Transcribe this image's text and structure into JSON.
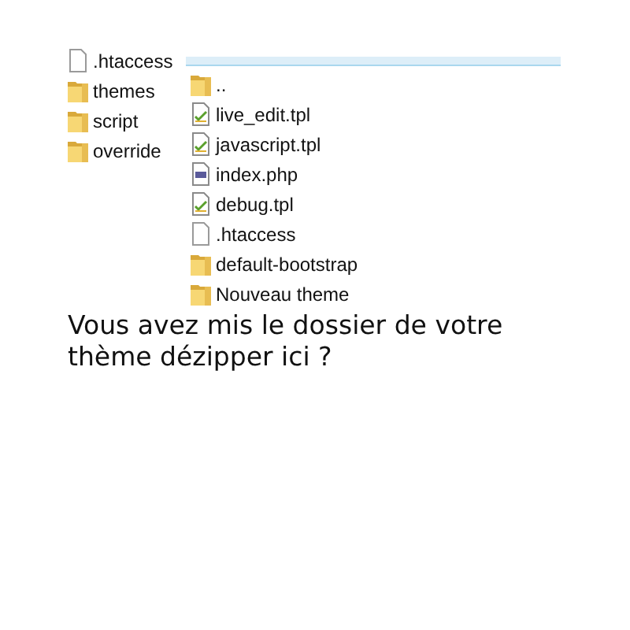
{
  "left_list": [
    {
      "kind": "file",
      "name": ".htaccess"
    },
    {
      "kind": "folder",
      "name": "themes"
    },
    {
      "kind": "folder",
      "name": "script"
    },
    {
      "kind": "folder",
      "name": "override"
    }
  ],
  "right_list": [
    {
      "kind": "folder",
      "name": ".."
    },
    {
      "kind": "tpl",
      "name": "live_edit.tpl"
    },
    {
      "kind": "tpl",
      "name": "javascript.tpl"
    },
    {
      "kind": "php",
      "name": "index.php"
    },
    {
      "kind": "tpl",
      "name": "debug.tpl"
    },
    {
      "kind": "file",
      "name": ".htaccess"
    },
    {
      "kind": "folder",
      "name": "default-bootstrap"
    },
    {
      "kind": "folder",
      "name": "Nouveau theme"
    }
  ],
  "message": "Vous avez mis le dossier de votre thème dézipper ici ?"
}
